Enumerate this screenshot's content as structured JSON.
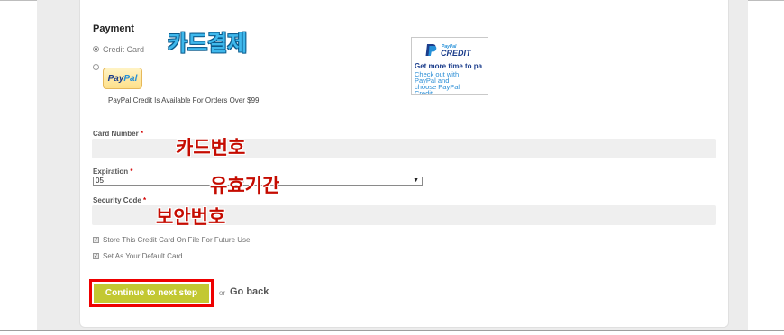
{
  "payment": {
    "title": "Payment",
    "credit_card_label": "Credit Card",
    "paypal_logo": {
      "part1": "Pay",
      "part2": "Pal"
    },
    "paypal_note": "PayPal Credit Is Available For Orders Over $99."
  },
  "paypal_credit_banner": {
    "logo_small": "PayPal",
    "logo_big": "CREDIT",
    "tagline": "Get more time to pa",
    "cta": "Check out with PayPal and choose PayPal Credit"
  },
  "fields": {
    "card_number_label": "Card Number",
    "expiration_label": "Expiration",
    "expiration_month_value": "05",
    "security_code_label": "Security Code",
    "required_mark": "*"
  },
  "options": {
    "store_card_label": "Store This Credit Card On File For Future Use.",
    "default_card_label": "Set As Your Default Card"
  },
  "actions": {
    "next_label": "Continue to next step",
    "or_text": "or",
    "back_label": "Go back"
  },
  "annotations": {
    "card_payment": "카드결제",
    "card_number": "카드번호",
    "expiry": "유효기간",
    "security_code": "보안번호"
  },
  "colors": {
    "next_button": "#c3c832",
    "highlight_frame": "#ee0000",
    "annotation_blue": "#3fb8ec",
    "annotation_red": "#c50b00",
    "paypal_navy": "#1b3d8c",
    "paypal_blue": "#2590d8"
  },
  "icons": {
    "credit_card_radio": "radio-checked-icon",
    "paypal_radio": "radio-unchecked-icon",
    "store_checkbox": "checkbox-checked-icon",
    "default_checkbox": "checkbox-checked-icon",
    "select_arrow": "dropdown-arrow-icon"
  }
}
